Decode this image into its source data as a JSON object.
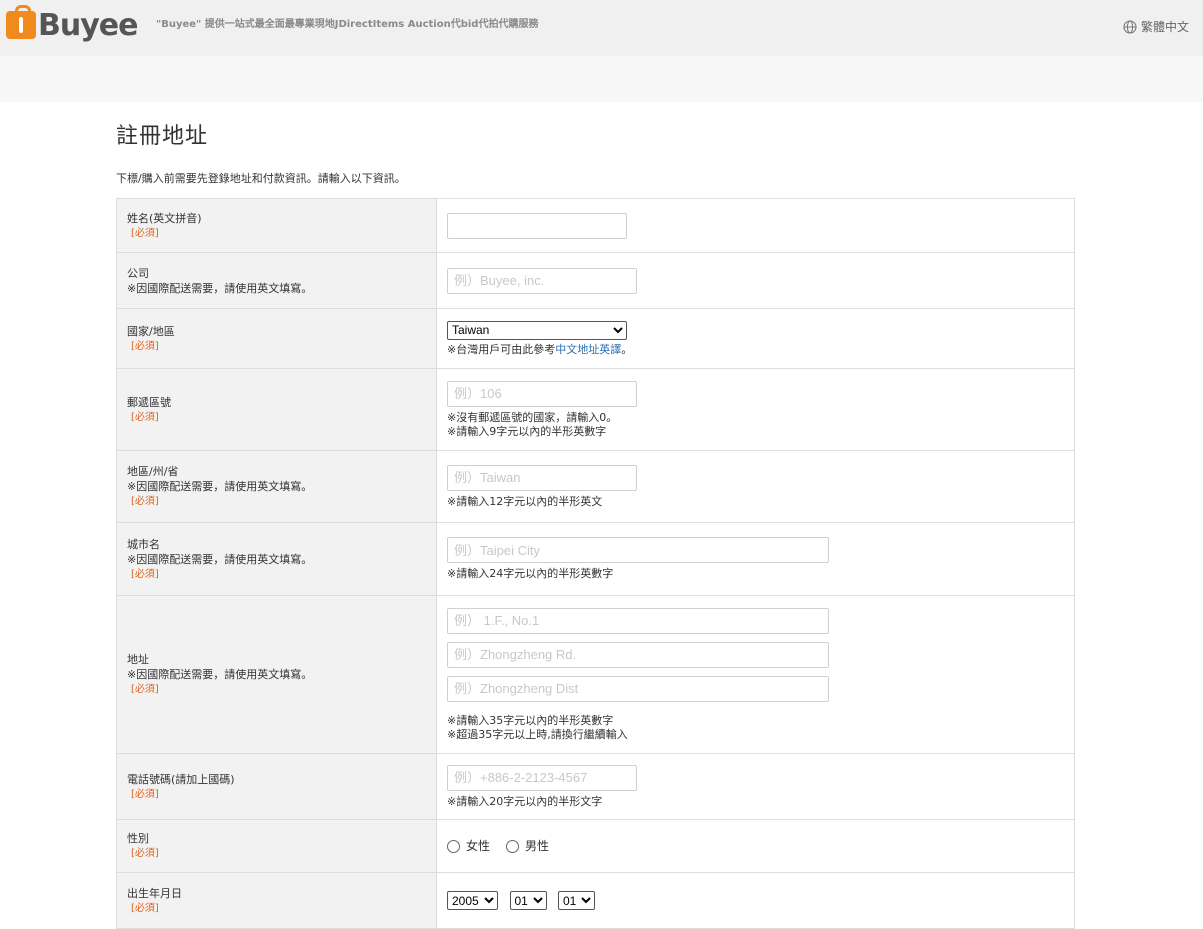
{
  "header": {
    "logo_text": "Buyee",
    "slogan": "\"Buyee\" 提供一站式最全面最專業現地JDirectItems Auction代bid代拍代購服務",
    "language": "繁體中文"
  },
  "page": {
    "title": "註冊地址",
    "intro": "下標/購入前需要先登錄地址和付款資訊。請輸入以下資訊。",
    "required_label": "[必須]",
    "english_note": "※因國際配送需要，請使用英文填寫。"
  },
  "fields": {
    "name": {
      "label": "姓名(英文拼音)",
      "value": ""
    },
    "company": {
      "label": "公司",
      "placeholder": "例）Buyee, inc."
    },
    "country": {
      "label": "國家/地區",
      "selected": "Taiwan",
      "hint_prefix": "※台灣用戶可由此參考",
      "hint_link": "中文地址英譯",
      "hint_suffix": "。"
    },
    "postal": {
      "label": "郵遞區號",
      "placeholder": "例）106",
      "hint1": "※沒有郵遞區號的國家，請輸入0。",
      "hint2": "※請輸入9字元以內的半形英數字"
    },
    "region": {
      "label": "地區/州/省",
      "placeholder": "例）Taiwan",
      "hint": "※請輸入12字元以內的半形英文"
    },
    "city": {
      "label": "城市名",
      "placeholder": "例）Taipei City",
      "hint": "※請輸入24字元以內的半形英數字"
    },
    "address": {
      "label": "地址",
      "placeholder1": "例） 1.F., No.1",
      "placeholder2": "例）Zhongzheng Rd.",
      "placeholder3": "例）Zhongzheng Dist",
      "hint1": "※請輸入35字元以內的半形英數字",
      "hint2": "※超過35字元以上時,請換行繼續輸入"
    },
    "phone": {
      "label": "電話號碼(請加上國碼)",
      "placeholder": "例）+886-2-2123-4567",
      "hint": "※請輸入20字元以內的半形文字"
    },
    "gender": {
      "label": "性別",
      "female": "女性",
      "male": "男性"
    },
    "birthday": {
      "label": "出生年月日",
      "year": "2005",
      "month": "01",
      "day": "01"
    }
  }
}
